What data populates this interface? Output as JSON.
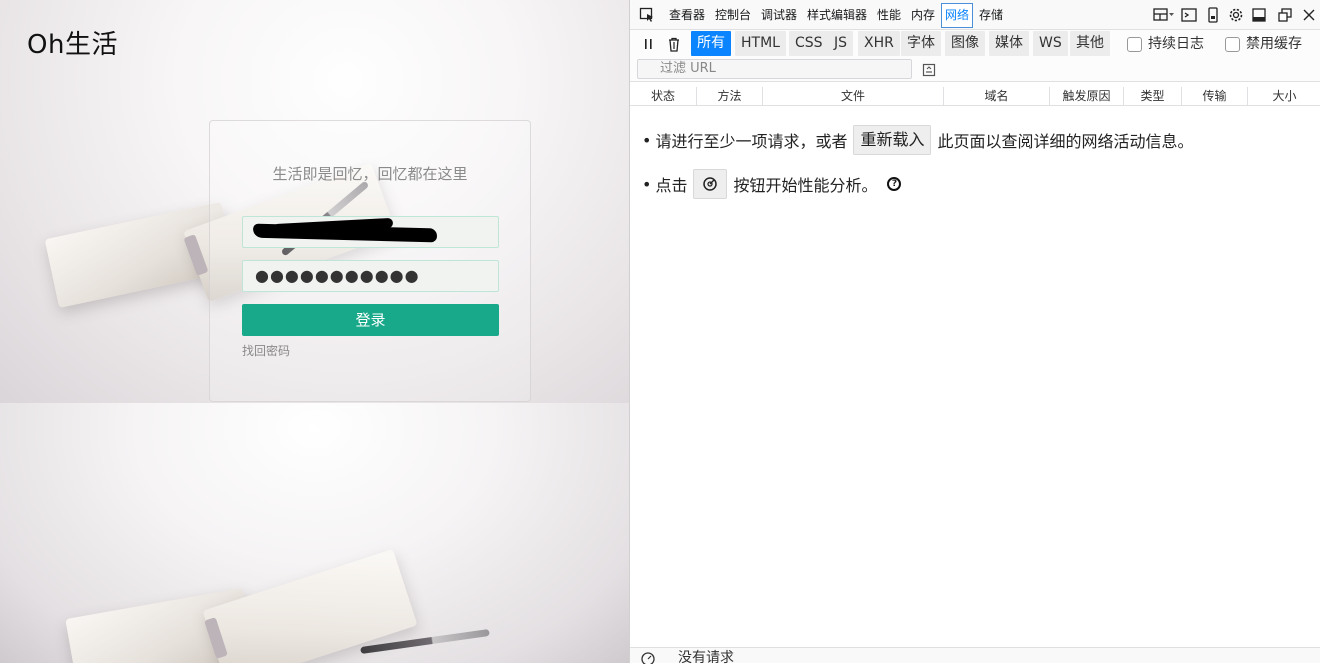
{
  "site": {
    "brand": "Oh生活",
    "tagline": "生活即是回忆，回忆都在这里",
    "password_mask": "●●●●●●●●●●●",
    "login_label": "登录",
    "forgot_label": "找回密码",
    "button_color": "#18a98a"
  },
  "devtools": {
    "tool_tabs": [
      "查看器",
      "控制台",
      "调试器",
      "样式编辑器",
      "性能",
      "内存",
      "网络",
      "存储"
    ],
    "active_tool_tab": "网络",
    "filter_tabs": [
      "所有",
      "HTML",
      "CSS",
      "JS",
      "XHR",
      "字体",
      "图像",
      "媒体",
      "WS",
      "其他"
    ],
    "active_filter_tab": "所有",
    "persist_logs_label": "持续日志",
    "disable_cache_label": "禁用缓存",
    "filter_placeholder": "过滤 URL",
    "columns": [
      "状态",
      "方法",
      "文件",
      "域名",
      "触发原因",
      "类型",
      "传输",
      "大小"
    ],
    "empty": {
      "line1_before": "请进行至少一项请求，或者",
      "reload_label": "重新载入",
      "line1_after": "此页面以查阅详细的网络活动信息。",
      "line2_before": "点击",
      "line2_after": "按钮开始性能分析。",
      "help_icon": "?"
    },
    "status_text": "没有请求",
    "accent": "#0a84ff"
  }
}
